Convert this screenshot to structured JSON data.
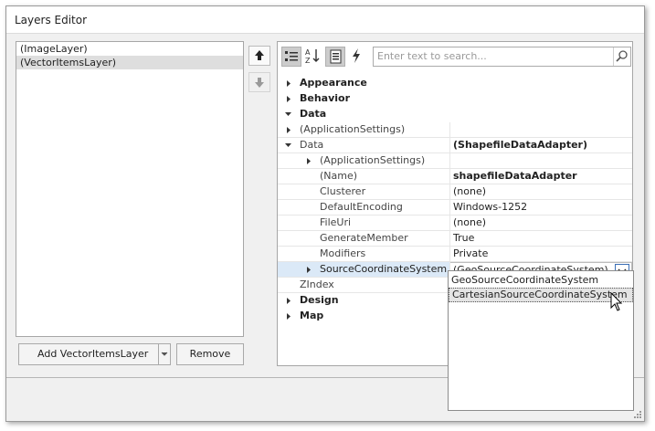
{
  "window": {
    "title": "Layers Editor"
  },
  "layers": [
    {
      "label": "(ImageLayer)",
      "selected": false
    },
    {
      "label": "(VectorItemsLayer)",
      "selected": true
    }
  ],
  "buttons": {
    "add_layer": "Add VectorItemsLayer",
    "remove": "Remove"
  },
  "property_grid": {
    "search_placeholder": "Enter text to search...",
    "toolbar": [
      "categorized-icon",
      "alphabetical-icon",
      "properties-icon",
      "events-icon"
    ],
    "rows": {
      "appearance": "Appearance",
      "behavior": "Behavior",
      "data_cat": "Data",
      "app_settings": "(ApplicationSettings)",
      "data": {
        "name": "Data",
        "value": "(ShapefileDataAdapter)"
      },
      "sub_app_settings": "(ApplicationSettings)",
      "name": {
        "name": "(Name)",
        "value": "shapefileDataAdapter"
      },
      "clusterer": {
        "name": "Clusterer",
        "value": "(none)"
      },
      "default_encoding": {
        "name": "DefaultEncoding",
        "value": "Windows-1252"
      },
      "file_uri": {
        "name": "FileUri",
        "value": "(none)"
      },
      "generate_member": {
        "name": "GenerateMember",
        "value": "True"
      },
      "modifiers": {
        "name": "Modifiers",
        "value": "Private"
      },
      "source_cs": {
        "name": "SourceCoordinateSystem",
        "value": "(GeoSourceCoordinateSystem)"
      },
      "zindex": {
        "name": "ZIndex"
      },
      "design": "Design",
      "map": "Map"
    },
    "dropdown_options": [
      "GeoSourceCoordinateSystem",
      "CartesianSourceCoordinateSystem"
    ],
    "dropdown_highlighted": "CartesianSourceCoordinateSystem"
  },
  "colors": {
    "selection": "#dbe9f7",
    "accent_border": "#3b6fb6"
  }
}
